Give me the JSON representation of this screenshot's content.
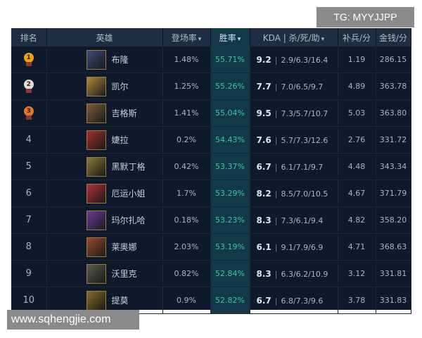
{
  "watermark_tag": "TG: MYYJJPP",
  "site_url": "www.sqhengjie.com",
  "table": {
    "headers": {
      "rank": "排名",
      "champion": "英雄",
      "pick_rate": "登场率",
      "win_rate": "胜率",
      "kda": "KDA | 杀/死/助",
      "cs": "补兵/分",
      "gold": "金钱/分"
    },
    "sort_icon": "chevron-down-icon",
    "rows": [
      {
        "rank": "1",
        "name": "布隆",
        "pick": "1.48%",
        "win": "55.71%",
        "kda": "9.2",
        "kda_detail": "2.9/6.3/16.4",
        "cs": "1.19",
        "gold": "286.15",
        "color": "#3a4a7a"
      },
      {
        "rank": "2",
        "name": "凯尔",
        "pick": "1.25%",
        "win": "55.26%",
        "kda": "7.7",
        "kda_detail": "7.0/6.5/9.7",
        "cs": "4.89",
        "gold": "363.78",
        "color": "#b08a3a"
      },
      {
        "rank": "3",
        "name": "吉格斯",
        "pick": "1.41%",
        "win": "55.04%",
        "kda": "9.5",
        "kda_detail": "7.3/5.7/10.7",
        "cs": "5.03",
        "gold": "363.80",
        "color": "#7a5a3a"
      },
      {
        "rank": "4",
        "name": "婕拉",
        "pick": "0.2%",
        "win": "54.43%",
        "kda": "7.6",
        "kda_detail": "5.7/7.3/12.6",
        "cs": "2.76",
        "gold": "331.72",
        "color": "#a0322a"
      },
      {
        "rank": "5",
        "name": "黑默丁格",
        "pick": "0.42%",
        "win": "53.37%",
        "kda": "6.7",
        "kda_detail": "6.1/7.1/9.7",
        "cs": "4.48",
        "gold": "343.34",
        "color": "#8a7a3a"
      },
      {
        "rank": "6",
        "name": "厄运小姐",
        "pick": "1.7%",
        "win": "53.29%",
        "kda": "8.2",
        "kda_detail": "8.5/7.0/10.5",
        "cs": "4.67",
        "gold": "371.79",
        "color": "#b0303a"
      },
      {
        "rank": "7",
        "name": "玛尔扎哈",
        "pick": "0.18%",
        "win": "53.23%",
        "kda": "8.3",
        "kda_detail": "7.3/6.1/9.4",
        "cs": "4.82",
        "gold": "358.20",
        "color": "#6a3a9a"
      },
      {
        "rank": "8",
        "name": "莱奥娜",
        "pick": "2.03%",
        "win": "53.19%",
        "kda": "6.1",
        "kda_detail": "9.1/7.9/6.9",
        "cs": "4.71",
        "gold": "368.63",
        "color": "#9a4a2a"
      },
      {
        "rank": "9",
        "name": "沃里克",
        "pick": "0.82%",
        "win": "52.84%",
        "kda": "8.3",
        "kda_detail": "6.3/6.2/10.9",
        "cs": "3.12",
        "gold": "331.81",
        "color": "#5a5a4a"
      },
      {
        "rank": "10",
        "name": "提莫",
        "pick": "0.9%",
        "win": "52.82%",
        "kda": "6.7",
        "kda_detail": "6.8/7.3/9.6",
        "cs": "3.78",
        "gold": "331.83",
        "color": "#8a6a2a"
      }
    ]
  },
  "colors": {
    "gold_medal": "#f0a21a",
    "silver_medal": "#dcdcdc",
    "bronze_medal": "#e07a2a",
    "win_rate_text": "#3ec7a0"
  }
}
